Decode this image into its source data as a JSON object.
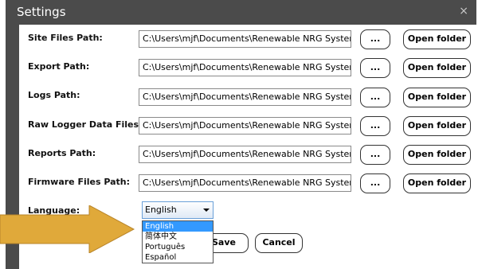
{
  "window": {
    "title": "Settings",
    "close_glyph": "×"
  },
  "paths": [
    {
      "label": "Site Files Path:",
      "value": "C:\\Users\\mjf\\Documents\\Renewable NRG Systems\\Sites",
      "browse": "...",
      "open": "Open folder"
    },
    {
      "label": "Export Path:",
      "value": "C:\\Users\\mjf\\Documents\\Renewable NRG Systems\\Export",
      "browse": "...",
      "open": "Open folder"
    },
    {
      "label": "Logs Path:",
      "value": "C:\\Users\\mjf\\Documents\\Renewable NRG Systems\\Logs",
      "browse": "...",
      "open": "Open folder"
    },
    {
      "label": "Raw Logger Data Files Path:",
      "value": "C:\\Users\\mjf\\Documents\\Renewable NRG Systems\\Raw",
      "browse": "...",
      "open": "Open folder"
    },
    {
      "label": "Reports Path:",
      "value": "C:\\Users\\mjf\\Documents\\Renewable NRG Systems\\Reports",
      "browse": "...",
      "open": "Open folder"
    },
    {
      "label": "Firmware Files Path:",
      "value": "C:\\Users\\mjf\\Documents\\Renewable NRG Systems\\Firmware",
      "browse": "...",
      "open": "Open folder"
    }
  ],
  "language": {
    "label": "Language:",
    "selected": "English",
    "options": [
      "English",
      "简体中文",
      "Português",
      "Español"
    ],
    "highlighted_option": "English"
  },
  "buttons": {
    "save": "Save",
    "cancel": "Cancel"
  },
  "colors": {
    "titlebar": "#4b4b4b",
    "highlight": "#3399ff",
    "arrow": "#e0a93a"
  },
  "icons": {
    "close": "close-icon",
    "arrow": "arrow-right-icon",
    "caret": "chevron-down-icon"
  }
}
